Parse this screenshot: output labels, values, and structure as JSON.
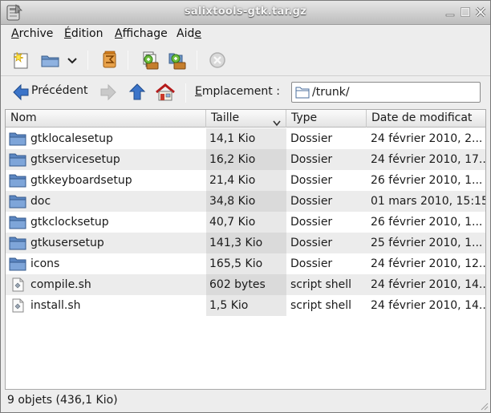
{
  "window": {
    "title": "salixtools-gtk.tar.gz"
  },
  "menubar": {
    "items": [
      {
        "label": "Archive",
        "mnemonic": "A",
        "rest": "rchive"
      },
      {
        "label": "Édition",
        "mnemonic": "É",
        "rest": "dition"
      },
      {
        "label": "Affichage",
        "mnemonic": "A",
        "rest": "ffichage"
      },
      {
        "label": "Aide",
        "pre": "Aid",
        "mnemonic": "e"
      }
    ]
  },
  "toolbar": {
    "buttons": [
      "new-archive-icon",
      "open-archive-icon",
      "open-dropdown-icon",
      "extract-icon",
      "add-files-icon",
      "add-folder-icon",
      "stop-icon"
    ]
  },
  "location": {
    "back_label": "Précédent",
    "label_mnemonic": "E",
    "label_rest": "mplacement :",
    "path": "/trunk/"
  },
  "columns": {
    "name": "Nom",
    "size": "Taille",
    "type": "Type",
    "date": "Date de modificat"
  },
  "files": [
    {
      "name": "gtklocalesetup",
      "size": "14,1 Kio",
      "type": "Dossier",
      "date": "24 février 2010, 2...",
      "icon": "folder-icon"
    },
    {
      "name": "gtkservicesetup",
      "size": "16,2 Kio",
      "type": "Dossier",
      "date": "24 février 2010, 17...",
      "icon": "folder-icon"
    },
    {
      "name": "gtkkeyboardsetup",
      "size": "21,4 Kio",
      "type": "Dossier",
      "date": "26 février 2010, 1...",
      "icon": "folder-icon"
    },
    {
      "name": "doc",
      "size": "34,8 Kio",
      "type": "Dossier",
      "date": "01 mars 2010, 15:15",
      "icon": "folder-icon"
    },
    {
      "name": "gtkclocksetup",
      "size": "40,7 Kio",
      "type": "Dossier",
      "date": "26 février 2010, 1...",
      "icon": "folder-icon"
    },
    {
      "name": "gtkusersetup",
      "size": "141,3 Kio",
      "type": "Dossier",
      "date": "25 février 2010, 1...",
      "icon": "folder-icon"
    },
    {
      "name": "icons",
      "size": "165,5 Kio",
      "type": "Dossier",
      "date": "24 février 2010, 12...",
      "icon": "folder-icon"
    },
    {
      "name": "compile.sh",
      "size": "602 bytes",
      "type": "script shell",
      "date": "24 février 2010, 14...",
      "icon": "script-file-icon"
    },
    {
      "name": "install.sh",
      "size": "1,5 Kio",
      "type": "script shell",
      "date": "24 février 2010, 14...",
      "icon": "script-file-icon"
    }
  ],
  "status": {
    "text": "9 objets (436,1 Kio)"
  }
}
